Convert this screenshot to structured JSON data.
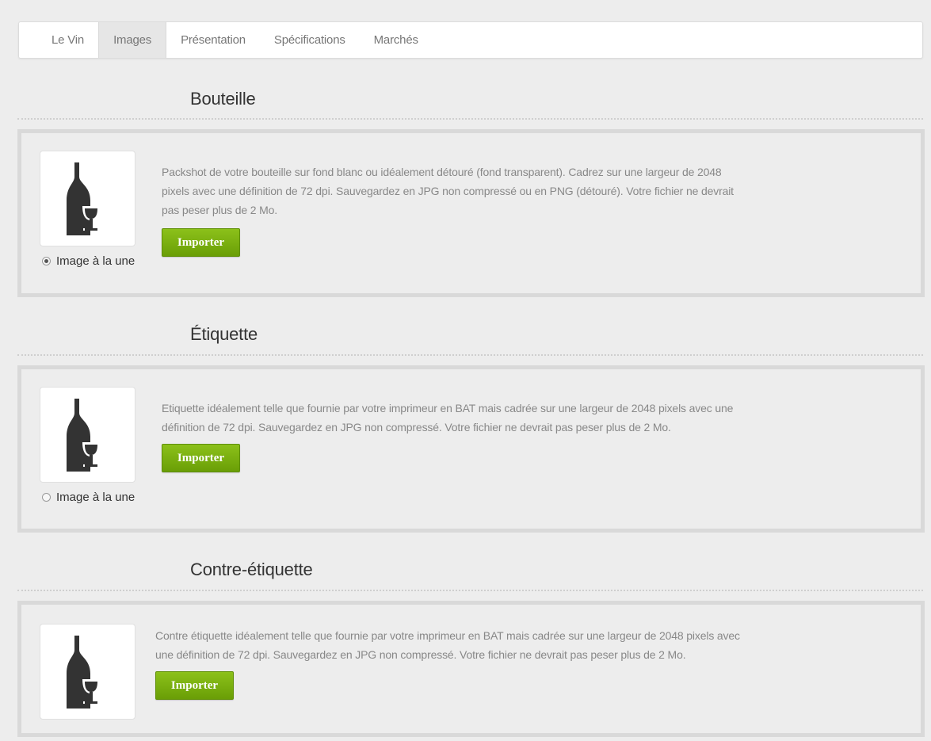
{
  "tabs": [
    "Le Vin",
    "Images",
    "Présentation",
    "Spécifications",
    "Marchés"
  ],
  "active_tab": "Images",
  "sections": [
    {
      "title": "Bouteille",
      "description": "Packshot de votre bouteille sur fond blanc ou idéalement détouré (fond transparent). Cadrez sur une largeur de 2048 pixels avec une définition de 72 dpi. Sauvegardez en JPG non compressé ou en PNG (détouré). Votre fichier ne devrait pas peser plus de 2 Mo.",
      "desc_lines": [
        "Packshot de votre bouteille sur fond blanc ou idéalement détouré (fond transparent). Cadrez sur une largeur de 2048",
        "pixels avec une définition de 72 dpi. Sauvegardez en JPG non compressé ou en PNG (détouré). Votre fichier ne devrait",
        "pas peser plus de 2 Mo."
      ],
      "button_label": "Importer",
      "radio_label": "Image à la une",
      "radio_checked": true,
      "thumbnail_icon": "wine-bottle-glass-icon"
    },
    {
      "title": "Étiquette",
      "desc_lines": [
        "Etiquette idéalement telle que fournie par votre imprimeur en BAT mais cadrée sur une largeur de 2048 pixels avec une",
        "définition de 72 dpi. Sauvegardez en JPG non compressé. Votre fichier ne devrait pas peser plus de 2 Mo."
      ],
      "button_label": "Importer",
      "radio_label": "Image à la une",
      "radio_checked": false,
      "thumbnail_icon": "wine-bottle-glass-icon"
    },
    {
      "title": "Contre-étiquette",
      "desc_lines": [
        "Contre étiquette idéalement telle que fournie par votre imprimeur en BAT mais cadrée sur une largeur de 2048 pixels avec",
        "une définition de 72 dpi. Sauvegardez en JPG non compressé. Votre fichier ne devrait pas peser plus de 2 Mo."
      ],
      "button_label": "Importer",
      "thumbnail_icon": "wine-bottle-glass-icon"
    }
  ],
  "colors": {
    "button_green": "#7aaf0f",
    "background": "#ededed",
    "card_border": "#d9d9d9"
  }
}
